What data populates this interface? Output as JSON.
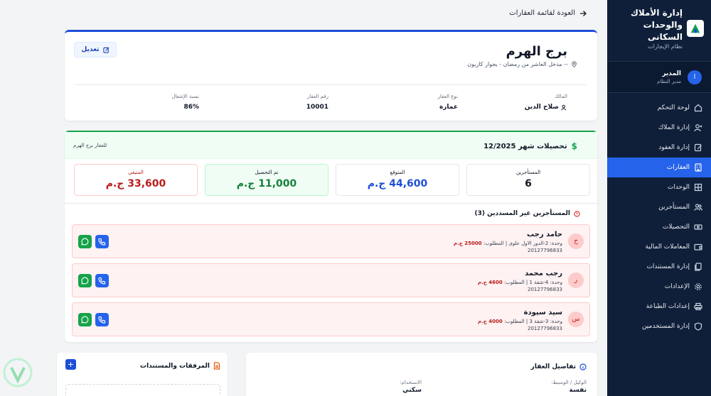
{
  "sidebar": {
    "title": "إدارة الأملاك والوحدات السكانى",
    "subtitle": "نظام الإيجارات",
    "user": {
      "initial": "ا",
      "name": "المدير",
      "role": "مدير النظام"
    },
    "items": [
      {
        "label": "لوحة التحكم",
        "icon": "home-icon"
      },
      {
        "label": "إدارة الملاك",
        "icon": "user-icon"
      },
      {
        "label": "إدارة العقود",
        "icon": "contract-icon"
      },
      {
        "label": "العقارات",
        "icon": "building-icon",
        "active": true
      },
      {
        "label": "الوحدات",
        "icon": "grid-icon"
      },
      {
        "label": "المستأجرين",
        "icon": "users-icon"
      },
      {
        "label": "التحصيلات",
        "icon": "cash-icon"
      },
      {
        "label": "المعاملات المالية",
        "icon": "wallet-icon"
      },
      {
        "label": "إدارة المستندات",
        "icon": "documents-icon"
      },
      {
        "label": "الإعدادات",
        "icon": "gear-icon"
      },
      {
        "label": "إعدادات الطباعة",
        "icon": "printer-icon"
      },
      {
        "label": "إدارة المستخدمين",
        "icon": "shield-icon"
      }
    ]
  },
  "back_label": "العودة لقائمة العقارات",
  "property": {
    "name": "برج الهرم",
    "address": "-- مدخل العاشر من رمضان - بجوار كازيون",
    "edit_label": "تعديل",
    "owner_label": "المالك",
    "owner": "صلاح الدين",
    "type_label": "نوع العقار",
    "type": "عمارة",
    "number_label": "رقم العقار",
    "number": "10001",
    "occupancy_label": "نسبة الإشغال",
    "occupancy": "86%"
  },
  "collections": {
    "title": "تحصيلات شهر 12/2025",
    "for_property": "للعقار برج الهرم",
    "stats": [
      {
        "label": "المستأجرين",
        "value": "6"
      },
      {
        "label": "المتوقع",
        "value": "44,600 ج.م"
      },
      {
        "label": "تم التحصيل",
        "value": "11,000 ج.م"
      },
      {
        "label": "المتبقي",
        "value": "33,600 ج.م"
      }
    ],
    "unpaid_title": "المستأجرين غير المسددين (3)",
    "tenants": [
      {
        "initial": "ح",
        "name": "حامد رجب",
        "unit": "وحدة: 2-الدور الاول علوى | المطلوب:",
        "due": "25000 ج.م",
        "phone": "20127796833"
      },
      {
        "initial": "ر",
        "name": "رجب محمد",
        "unit": "وحدة: 4-شقة 1 | المطلوب:",
        "due": "4600 ج.م",
        "phone": "20127796833"
      },
      {
        "initial": "س",
        "name": "سيد سيودة",
        "unit": "وحدة: 3-شقة 3 | المطلوب:",
        "due": "4000 ج.م",
        "phone": "20127796833"
      }
    ]
  },
  "details": {
    "title": "تفاصيل العقار",
    "agent_label": "الوكيل / الوسيط:",
    "agent": "نفسة",
    "usage_label": "الاستخدام:",
    "usage": "سكني"
  },
  "attachments": {
    "title": "المرفقات والمستندات",
    "add": "+"
  },
  "colors": {
    "sidebar": "#0f1f3a",
    "accent": "#2563eb",
    "green": "#16a34a",
    "red": "#b91c1c"
  }
}
